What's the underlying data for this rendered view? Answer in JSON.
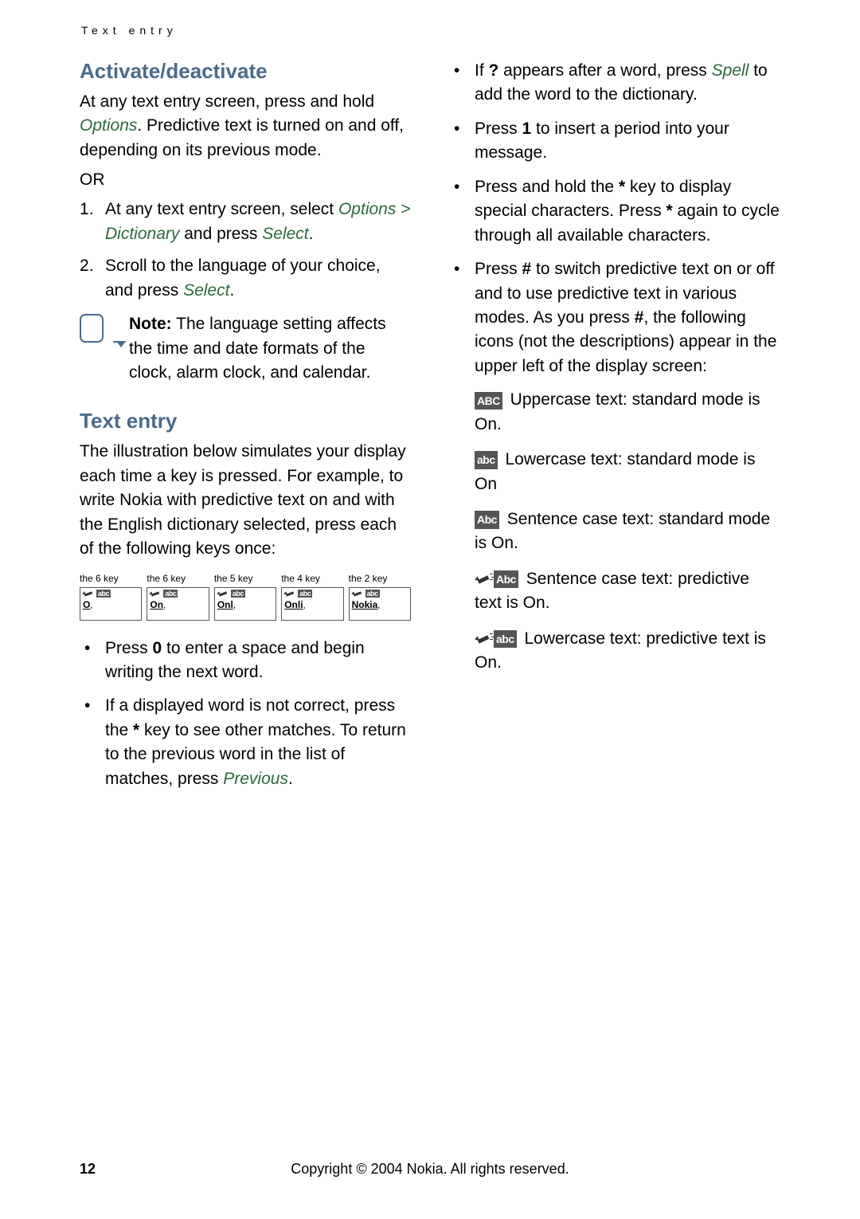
{
  "header": "Text entry",
  "left": {
    "h1": "Activate/deactivate",
    "p1a": "At any text entry screen, press and hold ",
    "p1b": ". Predictive text is turned on and off, depending on its previous mode.",
    "options": "Options",
    "or": "OR",
    "step1a": "At any text entry screen, select ",
    "step1b": " and press ",
    "options_dict": "Options > Dictionary",
    "select": "Select",
    "step2a": "Scroll to the language of your choice, and press ",
    "step2b": ".",
    "note_label": "Note:",
    "note_text": " The language setting affects the time and date formats of the clock, alarm clock, and calendar.",
    "h2": "Text entry",
    "p2": "The illustration below simulates your display each time a key is pressed. For example, to write Nokia with predictive text on and with the English dictionary selected, press each of the following keys once:",
    "keys": [
      {
        "label": "the 6 key",
        "word": "O",
        "abc": "abc"
      },
      {
        "label": "the 6 key",
        "word": "On",
        "abc": "abc"
      },
      {
        "label": "the 5 key",
        "word": "Onl",
        "abc": "abc"
      },
      {
        "label": "the 4 key",
        "word": "Onli",
        "abc": "abc"
      },
      {
        "label": "the 2 key",
        "word": "Nokia",
        "abc": "abc"
      }
    ],
    "b1a": "Press ",
    "b1_key": "0",
    "b1b": " to enter a space and begin writing the next word.",
    "b2a": "If a displayed word is not correct, press the ",
    "b2_key": "*",
    "b2b": " key to see other matches. To return to the previous word in the list of matches, press ",
    "previous": "Previous",
    "b2c": "."
  },
  "right": {
    "r1a": "If ",
    "r1_q": "?",
    "r1b": " appears after a word, press ",
    "spell": "Spell",
    "r1c": " to add the word to the dictionary.",
    "r2a": "Press ",
    "r2_key": "1",
    "r2b": " to insert a period into your message.",
    "r3a": "Press and hold the ",
    "r3_key1": "*",
    "r3b": " key to display special characters. Press ",
    "r3_key2": "*",
    "r3c": " again to cycle through all available characters.",
    "r4a": "Press ",
    "r4_key": "#",
    "r4b": " to switch predictive text on or off and to use predictive text in various modes. As you press ",
    "r4_key2": "#",
    "r4c": ", the following icons (not the descriptions) appear in the upper left of the display screen:",
    "m1_badge": "ABC",
    "m1_text": " Uppercase text: standard mode is On.",
    "m2_badge": "abc",
    "m2_text": " Lowercase text: standard mode is On",
    "m3_badge": "Abc",
    "m3_text": " Sentence case text: standard mode is On.",
    "m4_badge": "Abc",
    "m4_text": " Sentence case text: predictive text is On.",
    "m5_badge": "abc",
    "m5_text": " Lowercase text: predictive text is On."
  },
  "footer": "Copyright © 2004 Nokia. All rights reserved.",
  "page": "12"
}
